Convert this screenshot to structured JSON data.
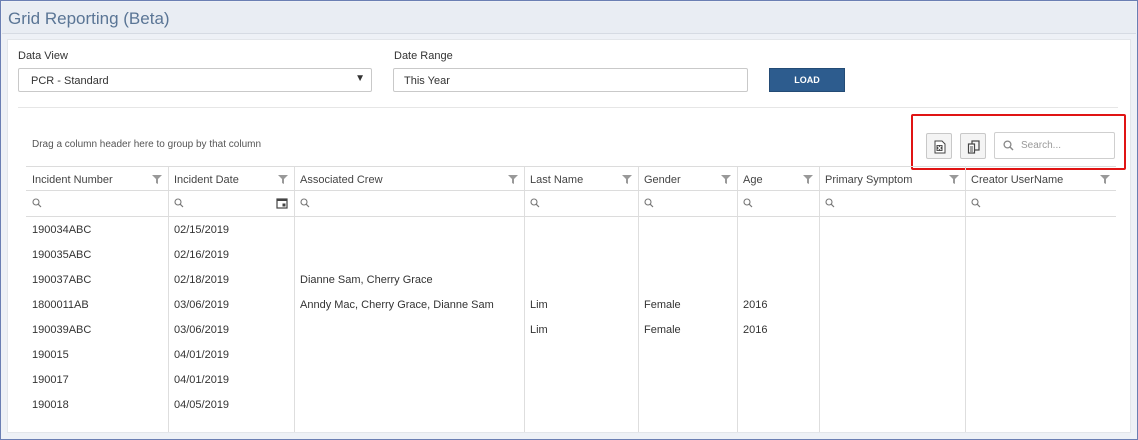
{
  "page": {
    "title": "Grid Reporting (Beta)"
  },
  "filters": {
    "data_view_label": "Data View",
    "data_view_value": "PCR - Standard",
    "date_range_label": "Date Range",
    "date_range_value": "This Year",
    "load_label": "LOAD"
  },
  "toolbar": {
    "group_hint": "Drag a column header here to group by that column",
    "search_placeholder": "Search..."
  },
  "grid": {
    "columns": [
      "Incident Number",
      "Incident Date",
      "Associated Crew",
      "Last Name",
      "Gender",
      "Age",
      "Primary Symptom",
      "Creator UserName"
    ],
    "rows": [
      [
        "190034ABC",
        "02/15/2019",
        "",
        "",
        "",
        "",
        "",
        ""
      ],
      [
        "190035ABC",
        "02/16/2019",
        "",
        "",
        "",
        "",
        "",
        ""
      ],
      [
        "190037ABC",
        "02/18/2019",
        "Dianne Sam, Cherry Grace",
        "",
        "",
        "",
        "",
        ""
      ],
      [
        "1800011AB",
        "03/06/2019",
        "Anndy Mac, Cherry Grace, Dianne Sam",
        "Lim",
        "Female",
        "2016",
        "",
        ""
      ],
      [
        "190039ABC",
        "03/06/2019",
        "",
        "Lim",
        "Female",
        "2016",
        "",
        ""
      ],
      [
        "190015",
        "04/01/2019",
        "",
        "",
        "",
        "",
        "",
        ""
      ],
      [
        "190017",
        "04/01/2019",
        "",
        "",
        "",
        "",
        "",
        ""
      ],
      [
        "190018",
        "04/05/2019",
        "",
        "",
        "",
        "",
        "",
        ""
      ]
    ]
  }
}
